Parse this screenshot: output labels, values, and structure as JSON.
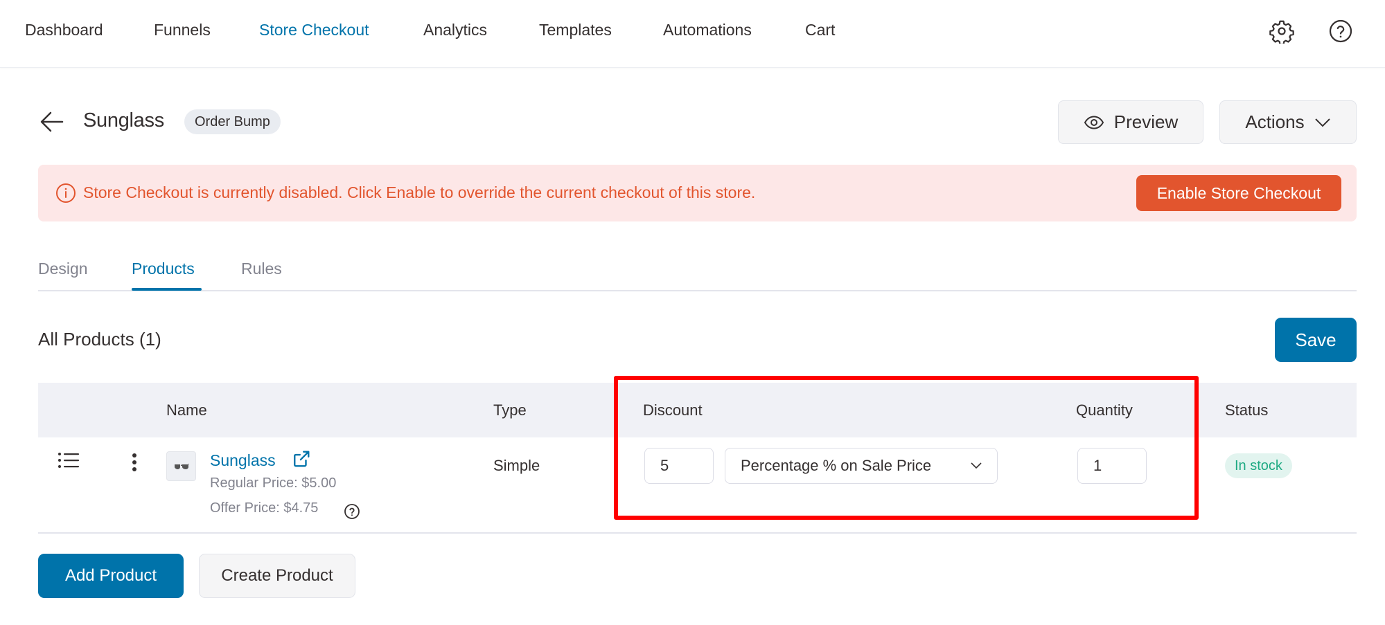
{
  "nav": {
    "items": [
      {
        "label": "Dashboard",
        "active": false
      },
      {
        "label": "Funnels",
        "active": false
      },
      {
        "label": "Store Checkout",
        "active": true
      },
      {
        "label": "Analytics",
        "active": false
      },
      {
        "label": "Templates",
        "active": false
      },
      {
        "label": "Automations",
        "active": false
      },
      {
        "label": "Cart",
        "active": false
      }
    ],
    "icons": [
      "gear-icon",
      "help-icon"
    ]
  },
  "header": {
    "title": "Sunglass",
    "type_badge": "Order Bump",
    "preview_label": "Preview",
    "actions_label": "Actions"
  },
  "alert": {
    "message": "Store Checkout is currently disabled. Click Enable to override the current checkout of this store.",
    "button_label": "Enable Store Checkout",
    "color": "#e2552e"
  },
  "tabs": [
    {
      "label": "Design",
      "active": false
    },
    {
      "label": "Products",
      "active": true
    },
    {
      "label": "Rules",
      "active": false
    }
  ],
  "products": {
    "section_title": "All Products (1)",
    "save_label": "Save",
    "columns": [
      "Name",
      "Type",
      "Discount",
      "Quantity",
      "Status"
    ],
    "rows": [
      {
        "name": "Sunglass",
        "regular_price": "Regular Price: $5.00",
        "offer_price": "Offer Price: $4.75",
        "type": "Simple",
        "discount_value": "5",
        "discount_type": "Percentage % on Sale Price",
        "quantity": "1",
        "status": "In stock"
      }
    ],
    "add_label": "Add Product",
    "create_label": "Create Product"
  },
  "colors": {
    "accent": "#0073aa",
    "danger": "#e2552e",
    "success": "#1eaa83",
    "highlight": "#ff0000"
  }
}
